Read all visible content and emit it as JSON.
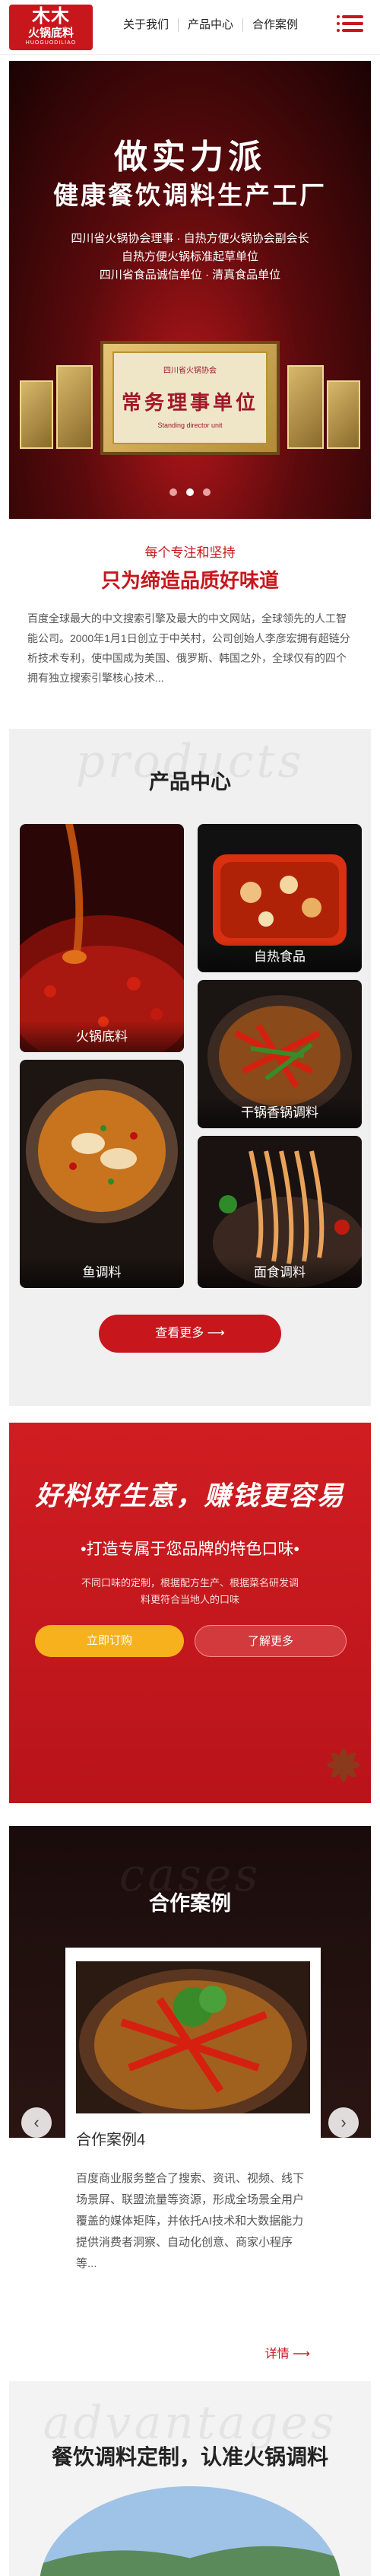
{
  "header": {
    "logo_mark": "木木",
    "logo_name": "火锅底料",
    "logo_pinyin": "HUOGUODILIAO",
    "nav": [
      "关于我们",
      "产品中心",
      "合作案例"
    ]
  },
  "banner": {
    "line1": "做实力派",
    "line2": "健康餐饮调料生产工厂",
    "subtitles": [
      "四川省火锅协会理事 · 自热方便火锅协会副会长",
      "自热方便火锅标准起草单位",
      "四川省食品诚信单位 · 清真食品单位"
    ],
    "plaque_line1": "四川省火锅协会",
    "plaque_title": "常务理事单位",
    "plaque_line3": "Standing director unit",
    "active_slide": 1
  },
  "intro": {
    "kicker": "每个专注和坚持",
    "title": "只为缔造品质好味道",
    "text": "百度全球最大的中文搜索引擎及最大的中文网站，全球领先的人工智能公司。2000年1月1日创立于中关村，公司创始人李彦宏拥有超链分析技术专利，使中国成为美国、俄罗斯、韩国之外，全球仅有的四个拥有独立搜索引擎核心技术..."
  },
  "products": {
    "ghost": "products",
    "title": "产品中心",
    "items": [
      {
        "label": "火锅底料"
      },
      {
        "label": "自热食品"
      },
      {
        "label": "干锅香锅调料"
      },
      {
        "label": "鱼调料"
      },
      {
        "label": "面食调料"
      }
    ],
    "more_label": "查看更多 ⟶"
  },
  "promo": {
    "slogan": "好料好生意，赚钱更容易",
    "subtitle": "•打造专属于您品牌的特色口味•",
    "text_lines": [
      "不同口味的定制，根据配方生产、根据菜名研发调",
      "料更符合当地人的口味"
    ],
    "order_label": "立即订购",
    "more_label": "了解更多"
  },
  "cases": {
    "ghost": "cases",
    "title": "合作案例",
    "case_title": "合作案例4",
    "case_text": "百度商业服务整合了搜索、资讯、视频、线下场景屏、联盟流量等资源，形成全场景全用户覆盖的媒体矩阵，并依托AI技术和大数据能力提供消费者洞察、自动化创意、商家小程序等...",
    "more_label": "详情 ⟶"
  },
  "advantages": {
    "ghost": "advantages",
    "title": "餐饮调料定制，认准火锅调料"
  },
  "colors": {
    "brand_red": "#c8161d",
    "accent_yellow": "#f6b11d"
  }
}
